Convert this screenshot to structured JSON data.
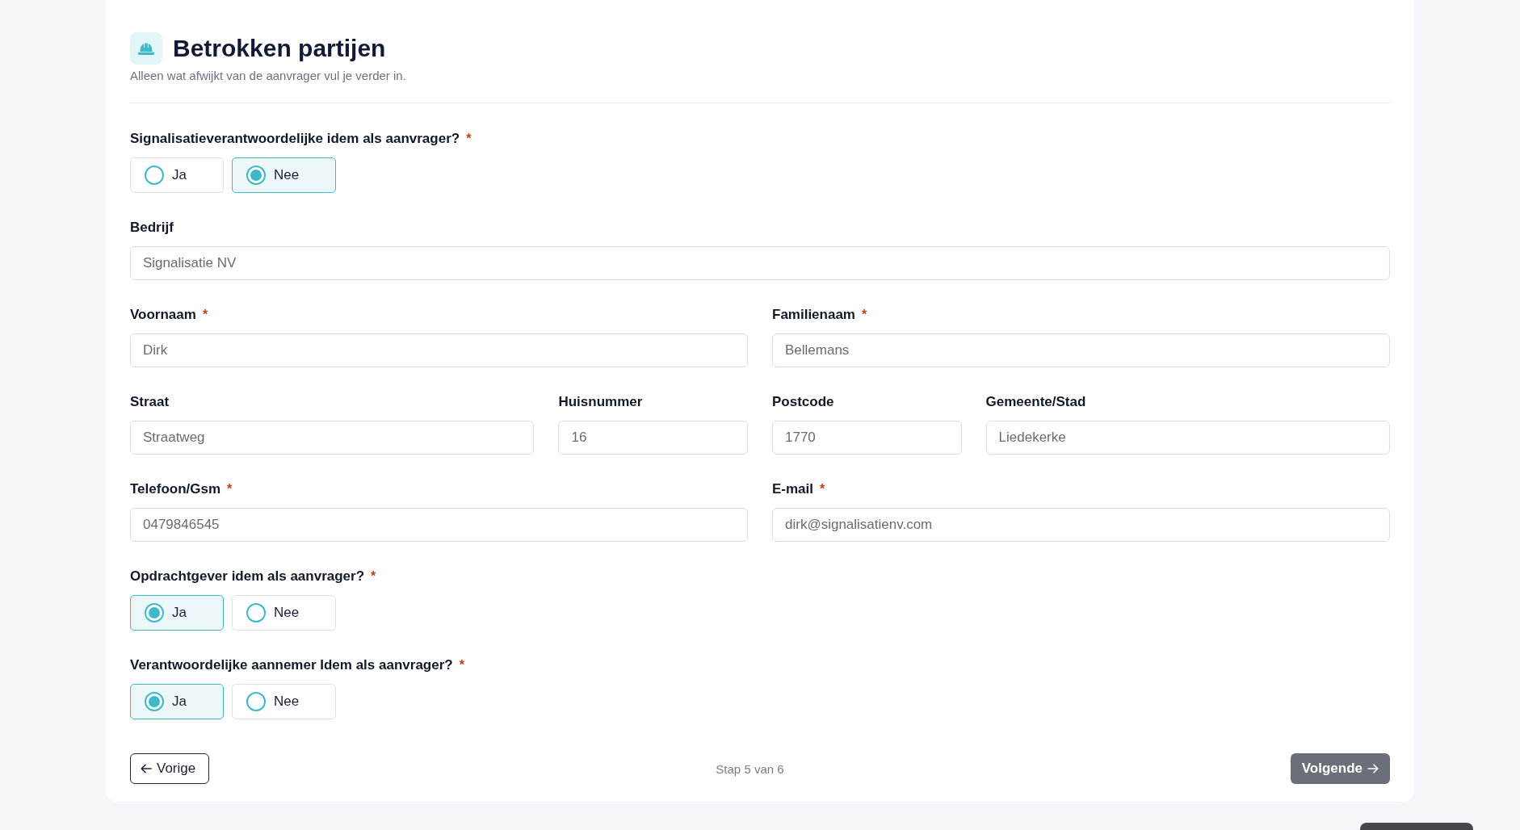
{
  "section": {
    "title": "Betrokken partijen",
    "subtitle": "Alleen wat afwijkt van de aanvrager vul je verder in."
  },
  "form": [
    {
      "kind": "radio",
      "label": "Signalisatieverantwoordelijke idem als aanvrager?",
      "required_mark": "*",
      "options": [
        {
          "label": "Ja",
          "selected": false
        },
        {
          "label": "Nee",
          "selected": true
        }
      ]
    },
    {
      "kind": "fields",
      "fields": [
        {
          "label": "Bedrijf",
          "value": "Signalisatie NV"
        }
      ]
    },
    {
      "kind": "fields",
      "fields": [
        {
          "label": "Voornaam",
          "required_mark": "*",
          "value": "Dirk"
        },
        {
          "label": "Familienaam",
          "required_mark": "*",
          "value": "Bellemans"
        }
      ]
    },
    {
      "kind": "fields",
      "fields": [
        {
          "label": "Straat",
          "value": "Straatweg"
        },
        {
          "label": "Huisnummer",
          "value": "16"
        },
        {
          "label": "Postcode",
          "value": "1770"
        },
        {
          "label": "Gemeente/Stad",
          "value": "Liedekerke"
        }
      ]
    },
    {
      "kind": "fields",
      "fields": [
        {
          "label": "Telefoon/Gsm",
          "required_mark": "*",
          "value": "0479846545"
        },
        {
          "label": "E-mail",
          "required_mark": "*",
          "value": "dirk@signalisatienv.com"
        }
      ]
    },
    {
      "kind": "radio",
      "label": "Opdrachtgever idem als aanvrager?",
      "required_mark": "*",
      "options": [
        {
          "label": "Ja",
          "selected": true
        },
        {
          "label": "Nee",
          "selected": false
        }
      ]
    },
    {
      "kind": "radio",
      "label": "Verantwoordelijke aannemer Idem als aanvrager?",
      "required_mark": "*",
      "options": [
        {
          "label": "Ja",
          "selected": true
        },
        {
          "label": "Nee",
          "selected": false
        }
      ]
    }
  ],
  "footer": {
    "back_button": {
      "label": "Vorige"
    },
    "step_text": "Stap 5 van 6",
    "next_button": {
      "label": "Volgende"
    }
  }
}
